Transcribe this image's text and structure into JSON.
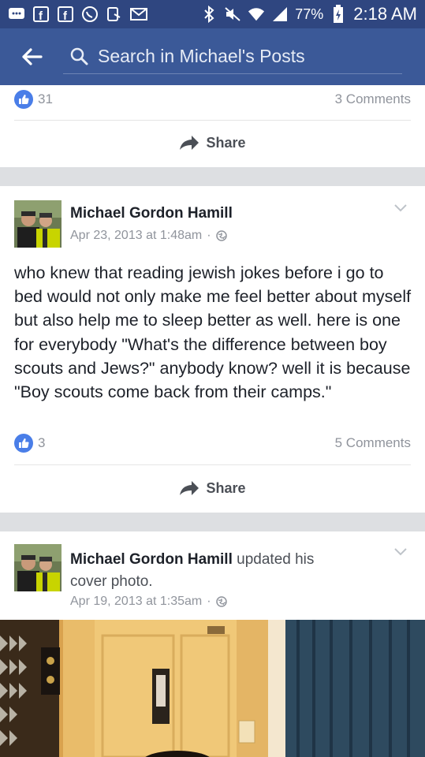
{
  "status_bar": {
    "battery_percent": "77%",
    "time": "2:18 AM",
    "icons": [
      "message-icon",
      "facebook-icon",
      "facebook-icon",
      "whatsapp-icon",
      "phone-icon",
      "gmail-icon",
      "bluetooth-icon",
      "mute-icon",
      "wifi-icon",
      "signal-icon",
      "battery-charging-icon"
    ]
  },
  "header": {
    "back_icon": "back-arrow-icon",
    "search_placeholder": "Search in Michael's Posts"
  },
  "posts": [
    {
      "likes": "31",
      "comments": "3 Comments",
      "share_label": "Share"
    },
    {
      "author": "Michael Gordon Hamill",
      "timestamp": "Apr 23, 2013 at 1:48am",
      "privacy_sep": "·",
      "text": "who knew that reading jewish jokes before i go to bed would not only make me feel better about myself but also help me to sleep better as well. here is one for everybody \"What's the difference between boy scouts and Jews?\" anybody know? well it is because \"Boy scouts come back from their camps.\"",
      "likes": "3",
      "comments": "5 Comments",
      "share_label": "Share"
    },
    {
      "author": "Michael Gordon Hamill",
      "action": "updated his cover photo.",
      "timestamp": "Apr 19, 2013 at 1:35am",
      "privacy_sep": "·"
    }
  ],
  "colors": {
    "status_bar": "#2f4680",
    "header": "#3b5998",
    "like_blue": "#4a7ee8",
    "feed_bg": "#dddfe2"
  }
}
